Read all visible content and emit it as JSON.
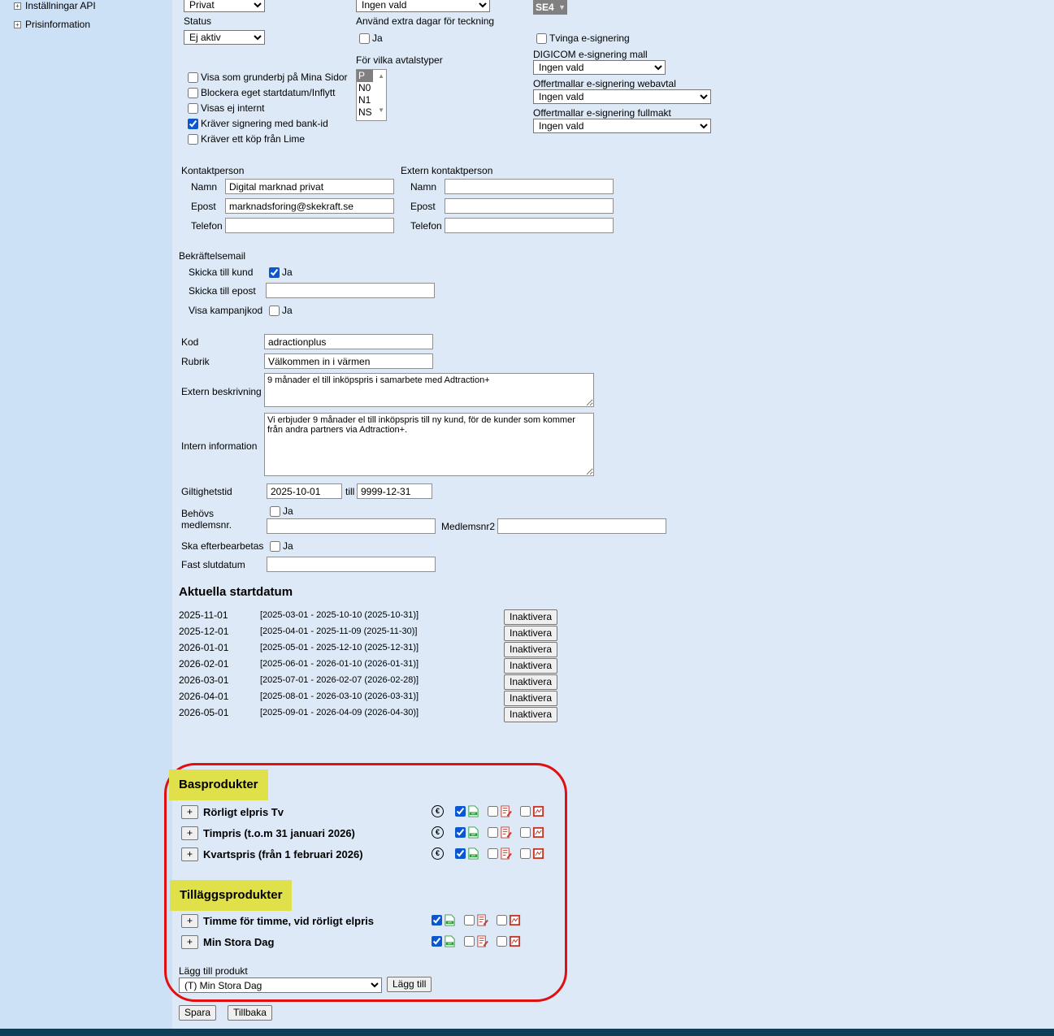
{
  "sidebar": {
    "items": [
      {
        "label": "Inställningar API"
      },
      {
        "label": "Prisinformation"
      }
    ]
  },
  "top": {
    "kundtyp_value": "Privat",
    "status_label": "Status",
    "status_value": "Ej aktiv",
    "extra_select_value": "Ingen vald",
    "extra_days_label": "Använd extra dagar för teckning",
    "extra_days_ja": "Ja",
    "avtalstyper_label": "För vilka avtalstyper",
    "avtalstyper_options": [
      "P",
      "N0",
      "N1",
      "NS"
    ],
    "se_value": "SE4",
    "checkboxes": [
      {
        "label": "Visa som grunderbj på Mina Sidor",
        "checked": false
      },
      {
        "label": "Blockera eget startdatum/Inflytt",
        "checked": false
      },
      {
        "label": "Visas ej internt",
        "checked": false
      },
      {
        "label": "Kräver signering med bank-id",
        "checked": true
      },
      {
        "label": "Kräver ett köp från Lime",
        "checked": false
      }
    ],
    "tvinga_label": "Tvinga e-signering",
    "digicom_label": "DIGICOM e-signering mall",
    "digicom_value": "Ingen vald",
    "webavtal_label": "Offertmallar e-signering webavtal",
    "webavtal_value": "Ingen vald",
    "fullmakt_label": "Offertmallar e-signering fullmakt",
    "fullmakt_value": "Ingen vald"
  },
  "kontakt": {
    "title": "Kontaktperson",
    "namn_label": "Namn",
    "namn_value": "Digital marknad privat",
    "epost_label": "Epost",
    "epost_value": "marknadsforing@skekraft.se",
    "telefon_label": "Telefon",
    "telefon_value": ""
  },
  "extern_kontakt": {
    "title": "Extern kontaktperson",
    "namn_label": "Namn",
    "epost_label": "Epost",
    "telefon_label": "Telefon"
  },
  "bekraftelse": {
    "title": "Bekräftelsemail",
    "skicka_kund_label": "Skicka till kund",
    "ja": "Ja",
    "skicka_epost_label": "Skicka till epost",
    "visa_kampanj_label": "Visa kampanjkod"
  },
  "details": {
    "kod_label": "Kod",
    "kod_value": "adractionplus",
    "rubrik_label": "Rubrik",
    "rubrik_value": "Välkommen in i värmen",
    "extern_label": "Extern beskrivning",
    "extern_value": "9 månader el till inköpspris i samarbete med Adtraction+",
    "intern_label": "Intern information",
    "intern_value": "Vi erbjuder 9 månader el till inköpspris till ny kund, för de kunder som kommer från andra partners via Adtraction+.",
    "giltighet_label": "Giltighetstid",
    "giltighet_from": "2025-10-01",
    "till_label": "till",
    "giltighet_to": "9999-12-31",
    "behovs_label_1": "Behövs",
    "behovs_label_2": "medlemsnr.",
    "ja": "Ja",
    "medlemsnr2_label": "Medlemsnr2",
    "efterbearbetas_label": "Ska efterbearbetas",
    "fast_slutdatum_label": "Fast slutdatum"
  },
  "startdatum": {
    "title": "Aktuella startdatum",
    "button_label": "Inaktivera",
    "rows": [
      {
        "date": "2025-11-01",
        "period": "[2025-03-01 - 2025-10-10 (2025-10-31)]"
      },
      {
        "date": "2025-12-01",
        "period": "[2025-04-01 - 2025-11-09 (2025-11-30)]"
      },
      {
        "date": "2026-01-01",
        "period": "[2025-05-01 - 2025-12-10 (2025-12-31)]"
      },
      {
        "date": "2026-02-01",
        "period": "[2025-06-01 - 2026-01-10 (2026-01-31)]"
      },
      {
        "date": "2026-03-01",
        "period": "[2025-07-01 - 2026-02-07 (2026-02-28)]"
      },
      {
        "date": "2026-04-01",
        "period": "[2025-08-01 - 2026-03-10 (2026-03-31)]"
      },
      {
        "date": "2026-05-01",
        "period": "[2025-09-01 - 2026-04-09 (2026-04-30)]"
      }
    ]
  },
  "basprodukter": {
    "title": "Basprodukter",
    "items": [
      {
        "name": "Rörligt elpris Tv"
      },
      {
        "name": "Timpris (t.o.m 31 januari 2026)"
      },
      {
        "name": "Kvartspris (från 1 februari 2026)"
      }
    ]
  },
  "tillagg": {
    "title": "Tilläggsprodukter",
    "items": [
      {
        "name": "Timme för timme, vid rörligt elpris"
      },
      {
        "name": "Min Stora Dag"
      }
    ]
  },
  "add_product": {
    "label": "Lägg till produkt",
    "value": "(T) Min Stora Dag",
    "button": "Lägg till"
  },
  "footer": {
    "save": "Spara",
    "back": "Tillbaka"
  },
  "colors": {
    "highlight": "#dfe04a",
    "frame": "#e01010",
    "sidebar": "#cce0f6",
    "page": "#dde9f6",
    "bottom_bar": "#0f3e57"
  },
  "icons": [
    "plus-box-icon",
    "euro-icon",
    "api-doc-icon",
    "edit-doc-icon",
    "signature-doc-icon",
    "dropdown-arrow-icon"
  ]
}
